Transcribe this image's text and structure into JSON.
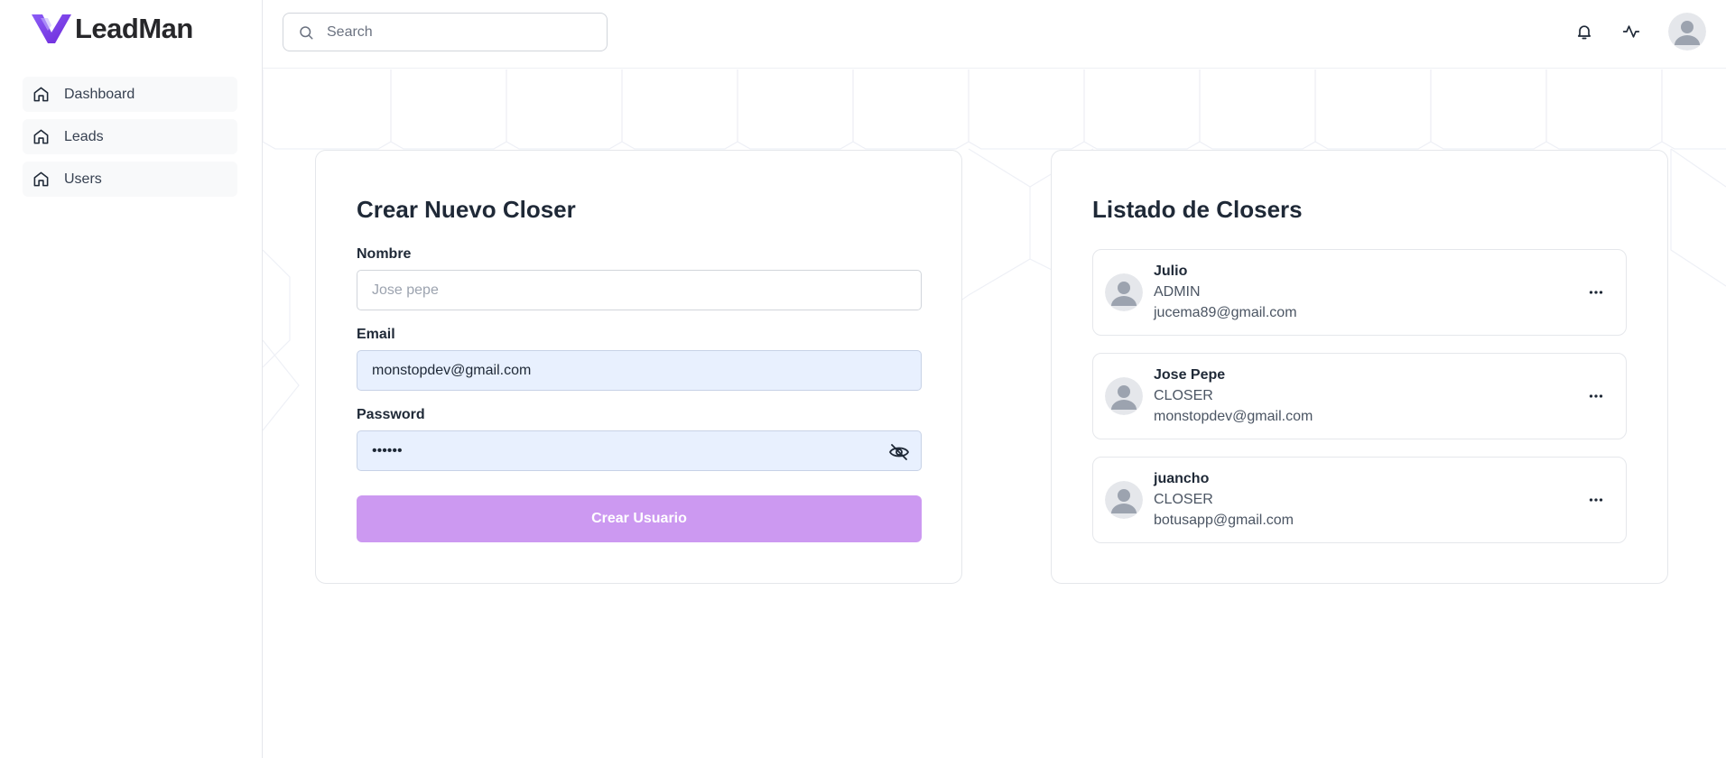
{
  "brand": {
    "name": "LeadMan",
    "color": "#7c3aed"
  },
  "sidebar": {
    "items": [
      {
        "label": "Dashboard",
        "icon": "home-icon"
      },
      {
        "label": "Leads",
        "icon": "home-icon"
      },
      {
        "label": "Users",
        "icon": "home-icon"
      }
    ]
  },
  "header": {
    "search_placeholder": "Search",
    "icons": [
      "bell-icon",
      "activity-icon",
      "user-avatar"
    ]
  },
  "form": {
    "title": "Crear Nuevo Closer",
    "nombre_label": "Nombre",
    "nombre_placeholder": "Jose pepe",
    "nombre_value": "",
    "email_label": "Email",
    "email_value": "monstopdev@gmail.com",
    "password_label": "Password",
    "password_value": "••••••",
    "submit_label": "Crear Usuario",
    "submit_color": "#cc99f1"
  },
  "list": {
    "title": "Listado de Closers",
    "closers": [
      {
        "name": "Julio",
        "role": "ADMIN",
        "email": "jucema89@gmail.com"
      },
      {
        "name": "Jose Pepe",
        "role": "CLOSER",
        "email": "monstopdev@gmail.com"
      },
      {
        "name": "juancho",
        "role": "CLOSER",
        "email": "botusapp@gmail.com"
      }
    ]
  }
}
